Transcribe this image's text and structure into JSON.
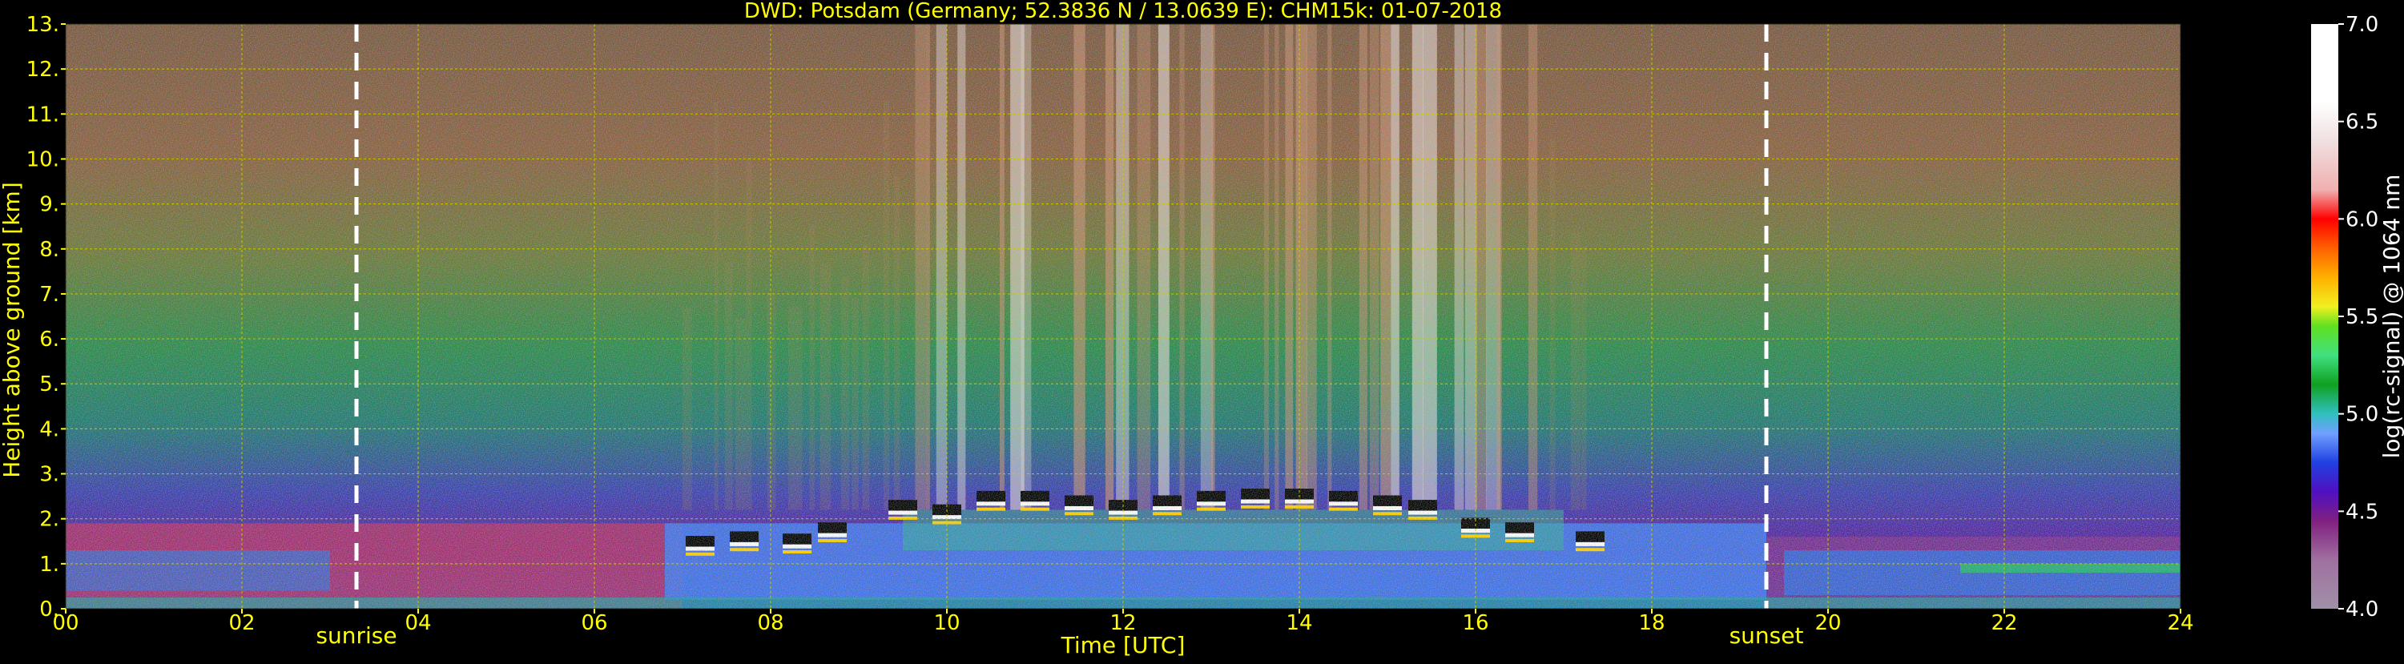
{
  "chart_data": {
    "type": "heatmap",
    "title": "DWD: Potsdam (Germany; 52.3836 N / 13.0639 E):    CHM15k: 01-07-2018",
    "xlabel": "Time [UTC]",
    "ylabel": "Height above ground [km]",
    "xlim": [
      0,
      24
    ],
    "ylim": [
      0,
      13
    ],
    "x_ticks": [
      "00",
      "02",
      "04",
      "06",
      "08",
      "10",
      "12",
      "14",
      "16",
      "18",
      "20",
      "22",
      "24"
    ],
    "y_ticks": [
      "0.",
      "1.",
      "2.",
      "3.",
      "4.",
      "5.",
      "6.",
      "7.",
      "8.",
      "9.",
      "10.",
      "11.",
      "12.",
      "13."
    ],
    "grid": true,
    "annotations": [
      {
        "label": "sunrise",
        "x": 3.3
      },
      {
        "label": "sunset",
        "x": 19.3
      }
    ],
    "colorbar": {
      "label": "log(rc-signal) @ 1064 nm",
      "range": [
        4.0,
        7.0
      ],
      "ticks": [
        "4.0",
        "4.5",
        "5.0",
        "5.5",
        "6.0",
        "6.5",
        "7.0"
      ],
      "stops": [
        {
          "v": 4.0,
          "c": "#a090a8"
        },
        {
          "v": 4.25,
          "c": "#a070a0"
        },
        {
          "v": 4.45,
          "c": "#802080"
        },
        {
          "v": 4.6,
          "c": "#5010c0"
        },
        {
          "v": 4.75,
          "c": "#2040e0"
        },
        {
          "v": 4.9,
          "c": "#70a0ff"
        },
        {
          "v": 5.0,
          "c": "#30c0c0"
        },
        {
          "v": 5.15,
          "c": "#10a020"
        },
        {
          "v": 5.3,
          "c": "#40e080"
        },
        {
          "v": 5.45,
          "c": "#60e020"
        },
        {
          "v": 5.55,
          "c": "#f0f020"
        },
        {
          "v": 5.7,
          "c": "#ffb000"
        },
        {
          "v": 5.85,
          "c": "#ff6000"
        },
        {
          "v": 6.0,
          "c": "#ff0000"
        },
        {
          "v": 6.15,
          "c": "#f0b0b0"
        },
        {
          "v": 6.4,
          "c": "#f0e0e0"
        },
        {
          "v": 6.6,
          "c": "#ffffff"
        },
        {
          "v": 7.0,
          "c": "#ffffff"
        }
      ]
    },
    "cloud_base": [
      {
        "t": 7.2,
        "h": 1.5
      },
      {
        "t": 7.7,
        "h": 1.6
      },
      {
        "t": 8.3,
        "h": 1.55
      },
      {
        "t": 8.7,
        "h": 1.8
      },
      {
        "t": 9.5,
        "h": 2.3
      },
      {
        "t": 10.0,
        "h": 2.2
      },
      {
        "t": 10.5,
        "h": 2.5
      },
      {
        "t": 11.0,
        "h": 2.5
      },
      {
        "t": 11.5,
        "h": 2.4
      },
      {
        "t": 12.0,
        "h": 2.3
      },
      {
        "t": 12.5,
        "h": 2.4
      },
      {
        "t": 13.0,
        "h": 2.5
      },
      {
        "t": 13.5,
        "h": 2.55
      },
      {
        "t": 14.0,
        "h": 2.55
      },
      {
        "t": 14.5,
        "h": 2.5
      },
      {
        "t": 15.0,
        "h": 2.4
      },
      {
        "t": 15.4,
        "h": 2.3
      },
      {
        "t": 16.0,
        "h": 1.9
      },
      {
        "t": 16.5,
        "h": 1.8
      },
      {
        "t": 17.3,
        "h": 1.6
      }
    ]
  }
}
